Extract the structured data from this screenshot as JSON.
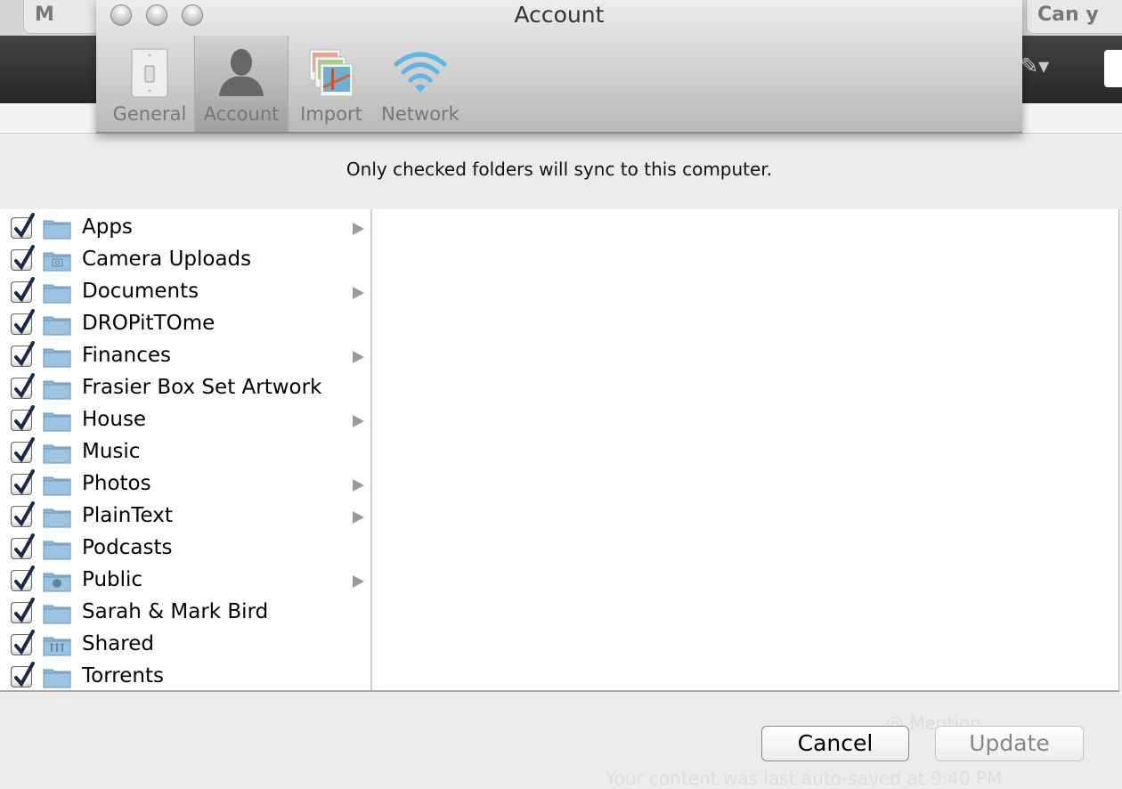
{
  "background": {
    "tab_left": "M",
    "tab_right": "Can y",
    "mention": "@ Mention",
    "autosave": "Your content was last auto-saved at 9:40 PM"
  },
  "window": {
    "title": "Account"
  },
  "toolbar": [
    {
      "label": "General",
      "icon": "light-switch-icon",
      "selected": false
    },
    {
      "label": "Account",
      "icon": "person-silhouette-icon",
      "selected": true
    },
    {
      "label": "Import",
      "icon": "photos-stack-icon",
      "selected": false
    },
    {
      "label": "Network",
      "icon": "wifi-icon",
      "selected": false
    }
  ],
  "message": "Only checked folders will sync to this computer.",
  "folders": [
    {
      "name": "Apps",
      "checked": true,
      "has_children": true,
      "icon": "folder"
    },
    {
      "name": "Camera Uploads",
      "checked": true,
      "has_children": false,
      "icon": "camera-folder"
    },
    {
      "name": "Documents",
      "checked": true,
      "has_children": true,
      "icon": "folder"
    },
    {
      "name": "DROPitTOme",
      "checked": true,
      "has_children": false,
      "icon": "folder"
    },
    {
      "name": "Finances",
      "checked": true,
      "has_children": true,
      "icon": "folder"
    },
    {
      "name": "Frasier Box Set Artwork",
      "checked": true,
      "has_children": false,
      "icon": "folder"
    },
    {
      "name": "House",
      "checked": true,
      "has_children": true,
      "icon": "folder"
    },
    {
      "name": "Music",
      "checked": true,
      "has_children": false,
      "icon": "folder"
    },
    {
      "name": "Photos",
      "checked": true,
      "has_children": true,
      "icon": "folder"
    },
    {
      "name": "PlainText",
      "checked": true,
      "has_children": true,
      "icon": "folder"
    },
    {
      "name": "Podcasts",
      "checked": true,
      "has_children": false,
      "icon": "folder"
    },
    {
      "name": "Public",
      "checked": true,
      "has_children": true,
      "icon": "public-folder"
    },
    {
      "name": "Sarah & Mark Bird",
      "checked": true,
      "has_children": false,
      "icon": "folder"
    },
    {
      "name": "Shared",
      "checked": true,
      "has_children": false,
      "icon": "shared-folder"
    },
    {
      "name": "Torrents",
      "checked": true,
      "has_children": false,
      "icon": "folder"
    }
  ],
  "buttons": {
    "cancel": "Cancel",
    "update": "Update"
  },
  "colors": {
    "checkmark": "#1c2a4a",
    "folder": "#9cc3e2",
    "wifi": "#5fb4e8"
  }
}
